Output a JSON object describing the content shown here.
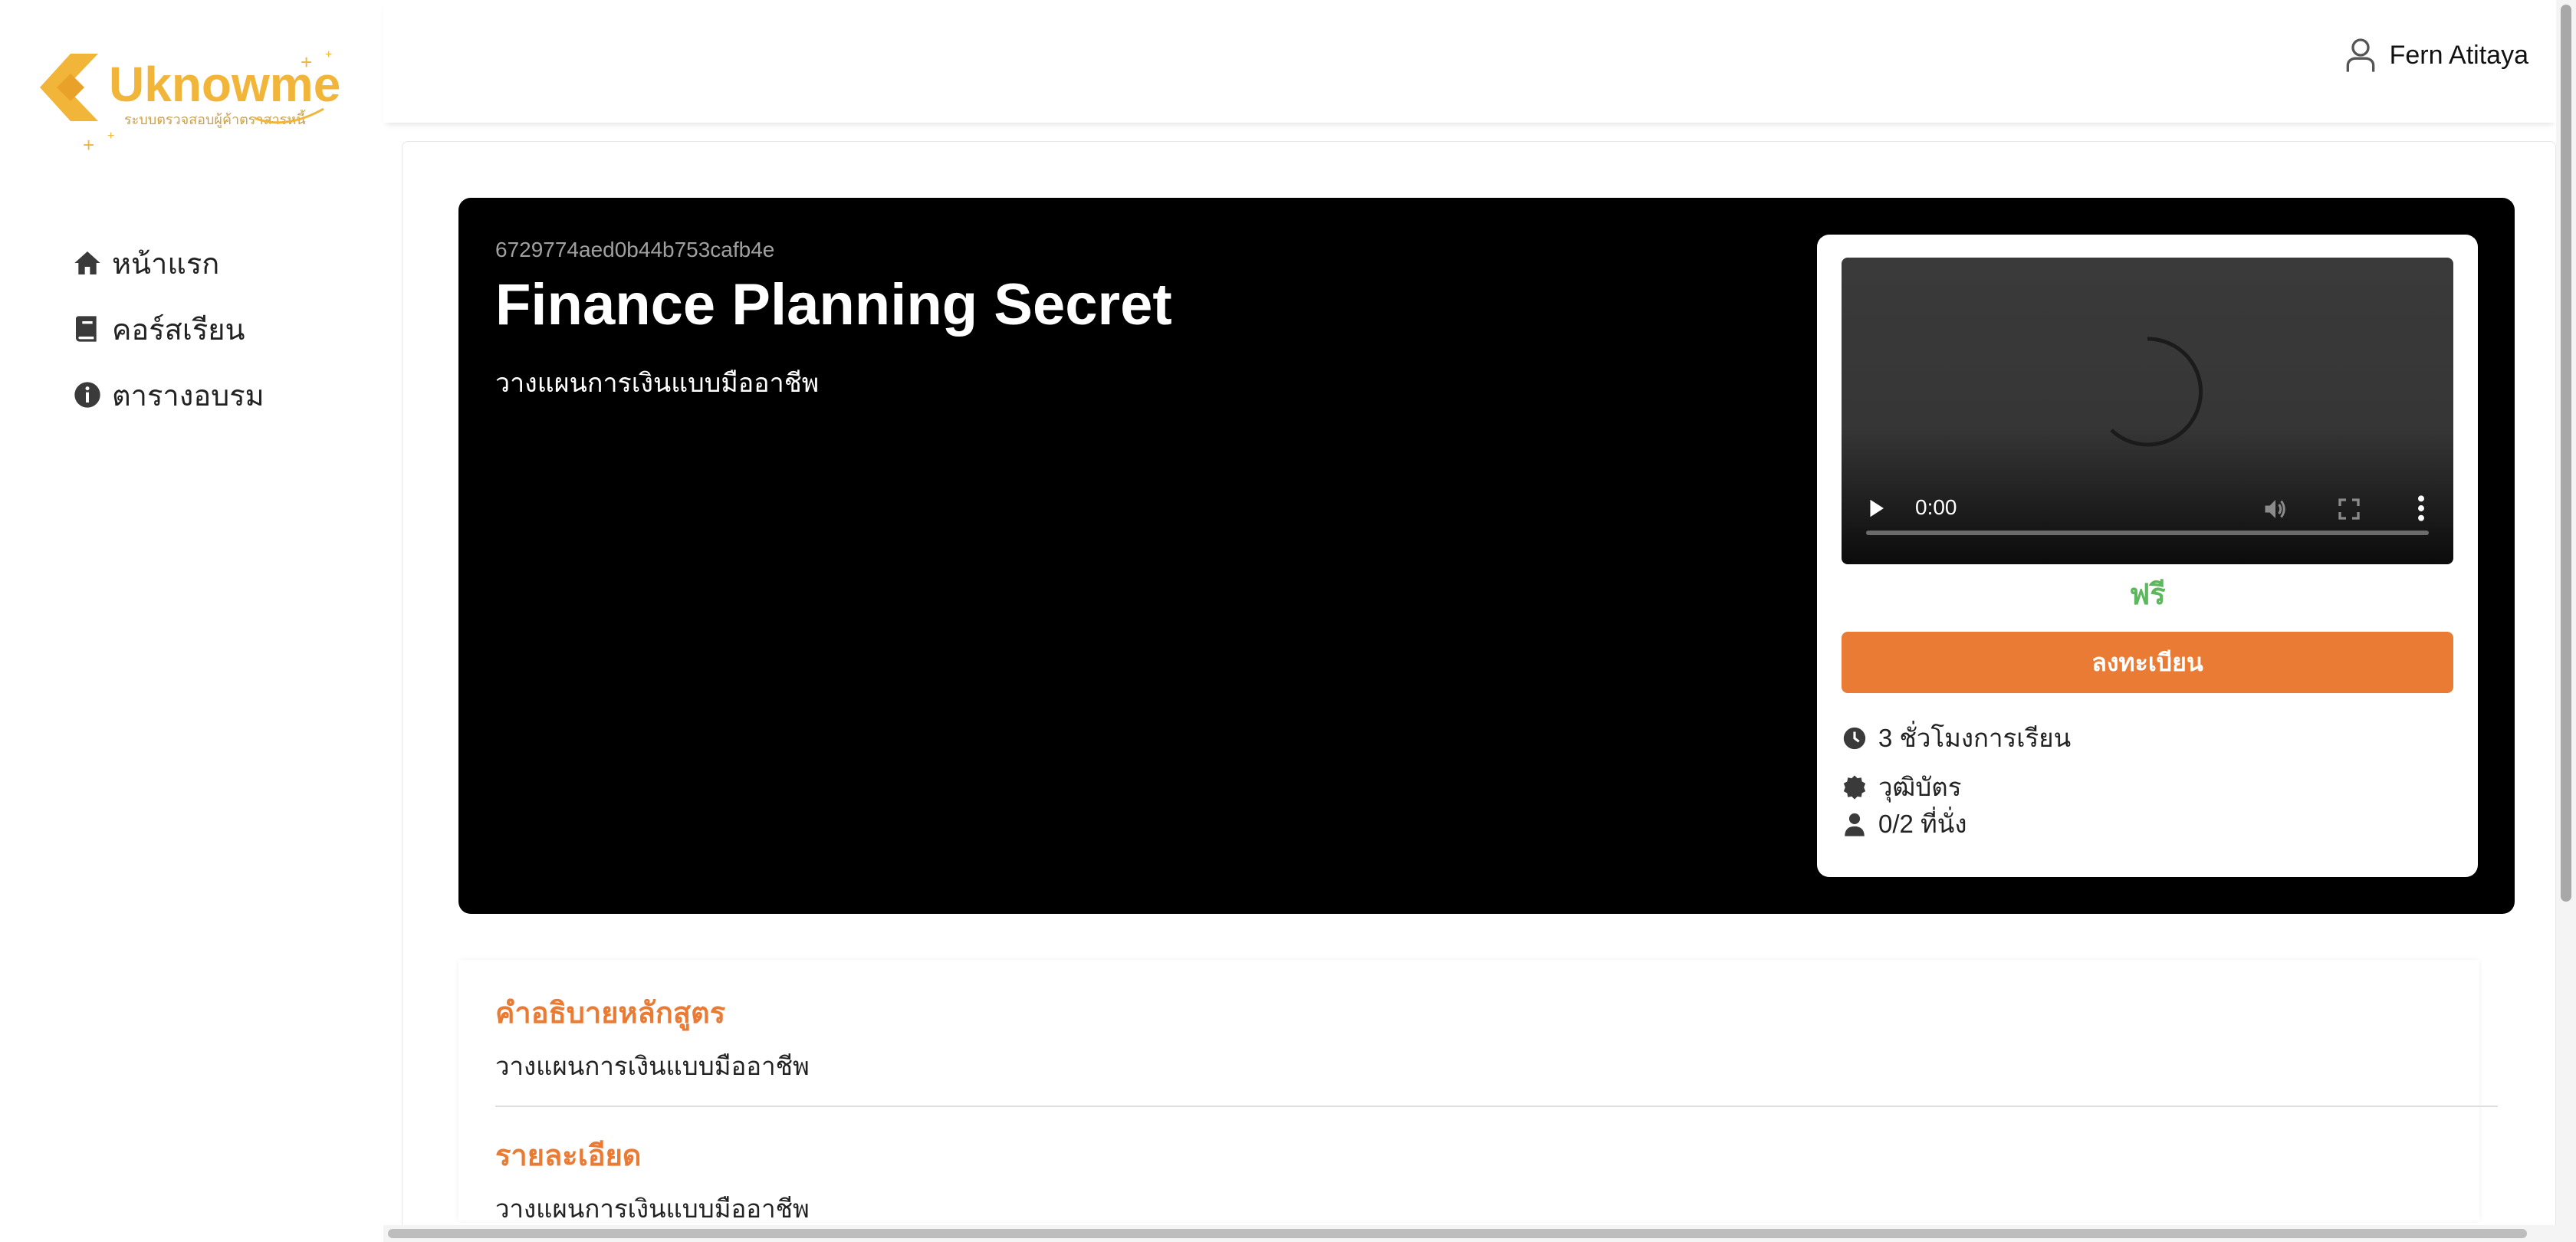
{
  "brand": {
    "name": "Uknowme",
    "tagline": "ระบบตรวจสอบผู้ค้าตราสารหนี้",
    "colors": {
      "accent": "#ea7b35",
      "logo_yellow": "#f1b53a",
      "price_green": "#5cb85c"
    }
  },
  "sidebar": {
    "items": [
      {
        "label": "หน้าแรก",
        "icon": "home-icon"
      },
      {
        "label": "คอร์สเรียน",
        "icon": "book-icon"
      },
      {
        "label": "ตารางอบรม",
        "icon": "info-circle-icon"
      }
    ]
  },
  "header": {
    "user_name": "Fern Atitaya",
    "user_icon": "user-icon"
  },
  "course": {
    "id": "6729774aed0b44b753cafb4e",
    "title": "Finance Planning Secret",
    "subtitle": "วางแผนการเงินแบบมืออาชีพ",
    "video": {
      "time": "0:00"
    },
    "price": "ฟรี",
    "enroll_label": "ลงทะเบียน",
    "duration": "3 ชั่วโมงการเรียน",
    "certificate": "วุฒิบัตร",
    "seats": "0/2 ที่นั่ง"
  },
  "details": {
    "description_heading": "คำอธิบายหลักสูตร",
    "description_text": "วางแผนการเงินแบบมืออาชีพ",
    "detail_heading": "รายละเอียด",
    "detail_text": "วางแผนการเงินแบบมืออาชีพ"
  }
}
